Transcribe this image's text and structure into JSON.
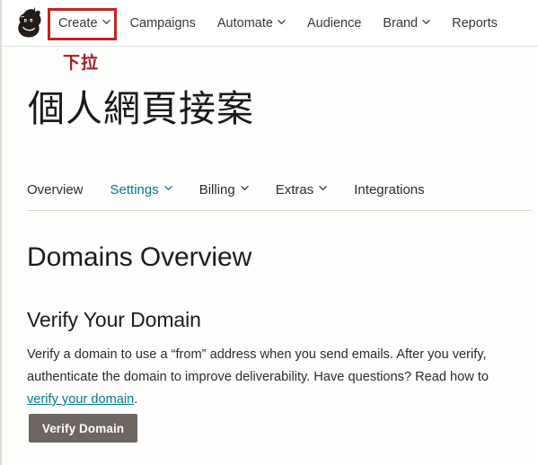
{
  "header": {
    "logo_name": "mailchimp-freddie-logo",
    "nav_items": [
      {
        "label": "Create",
        "has_caret": true,
        "name": "create"
      },
      {
        "label": "Campaigns",
        "has_caret": false,
        "name": "campaigns"
      },
      {
        "label": "Automate",
        "has_caret": true,
        "name": "automate"
      },
      {
        "label": "Audience",
        "has_caret": false,
        "name": "audience"
      },
      {
        "label": "Brand",
        "has_caret": true,
        "name": "brand"
      },
      {
        "label": "Reports",
        "has_caret": false,
        "name": "reports"
      }
    ]
  },
  "annotation": {
    "label": "下拉",
    "color": "#a81e1e",
    "box_color": "#c62121",
    "targets": "Create"
  },
  "page": {
    "title": "個人網頁接案"
  },
  "tabs": [
    {
      "label": "Overview",
      "has_caret": false,
      "active": false
    },
    {
      "label": "Settings",
      "has_caret": true,
      "active": true
    },
    {
      "label": "Billing",
      "has_caret": true,
      "active": false
    },
    {
      "label": "Extras",
      "has_caret": true,
      "active": false
    },
    {
      "label": "Integrations",
      "has_caret": false,
      "active": false
    }
  ],
  "main": {
    "heading": "Domains Overview",
    "subheading": "Verify Your Domain",
    "body_part1": "Verify a domain to use a “from” address when you send emails. After you verify, authenticate the domain to improve deliverability. Have questions? Read how to ",
    "body_link": "verify your domain",
    "body_part2": ".",
    "verify_button": "Verify Domain"
  },
  "colors": {
    "accent_teal": "#007c89",
    "annotation_red": "#c62121",
    "button_grey": "#6d6660",
    "text_dark": "#241c15"
  }
}
